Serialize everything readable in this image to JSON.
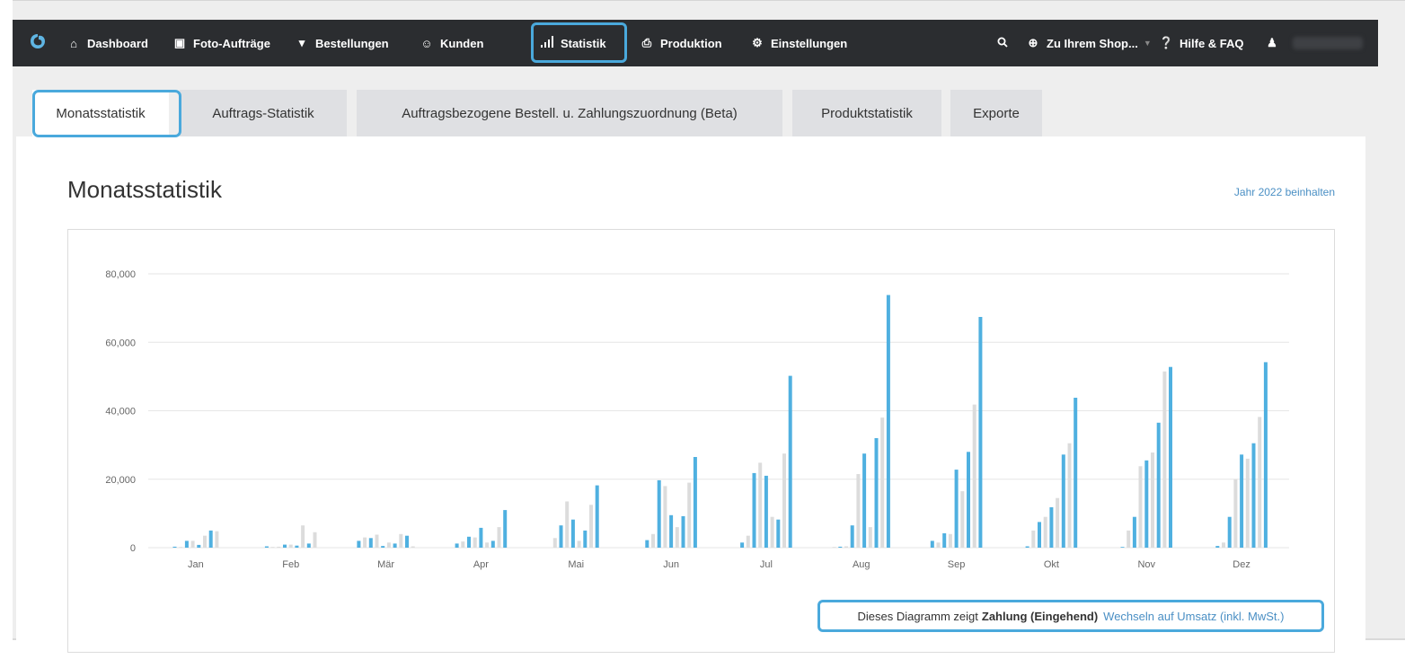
{
  "nav": {
    "items": [
      {
        "icon": "home-icon",
        "glyph": "⌂",
        "label": "Dashboard"
      },
      {
        "icon": "camera-icon",
        "glyph": "▣",
        "label": "Foto-Aufträge"
      },
      {
        "icon": "cart-icon",
        "glyph": "▾",
        "label": "Bestellungen"
      },
      {
        "icon": "users-icon",
        "glyph": "☺",
        "label": "Kunden"
      },
      {
        "icon": "bar-chart-icon",
        "glyph": "▐",
        "label": "Statistik"
      },
      {
        "icon": "printer-icon",
        "glyph": "⎙",
        "label": "Produktion"
      },
      {
        "icon": "gear-icon",
        "glyph": "⚙",
        "label": "Einstellungen"
      }
    ],
    "right": {
      "shop_label": "Zu Ihrem Shop...",
      "help_label": "Hilfe & FAQ"
    }
  },
  "tabs": [
    "Monatsstatistik",
    "Auftrags-Statistik",
    "Auftragsbezogene Bestell. u. Zahlungszuordnung (Beta)",
    "Produktstatistik",
    "Exporte"
  ],
  "page": {
    "title": "Monatsstatistik",
    "year_link": "Jahr 2022 beinhalten"
  },
  "footer": {
    "prefix": "Dieses Diagramm zeigt",
    "bold": "Zahlung (Eingehend)",
    "link": "Wechseln auf Umsatz (inkl. MwSt.)"
  },
  "colors": {
    "accent": "#4aa9dc",
    "bar_blue": "#4fb0e0",
    "bar_gray": "#dcdcdc",
    "nav_bg": "#2b2d30"
  },
  "chart_data": {
    "type": "bar",
    "categories": [
      "Jan",
      "Feb",
      "Mär",
      "Apr",
      "Mai",
      "Jun",
      "Jul",
      "Aug",
      "Sep",
      "Okt",
      "Nov",
      "Dez"
    ],
    "yticks": [
      "0",
      "20,000",
      "40,000",
      "60,000",
      "80,000"
    ],
    "ylim": [
      0,
      80000
    ],
    "grid": true,
    "bars_per_month": [
      [
        {
          "v": 300,
          "c": "b"
        },
        {
          "v": 200,
          "c": "g"
        },
        {
          "v": 2000,
          "c": "b"
        },
        {
          "v": 2000,
          "c": "g"
        },
        {
          "v": 800,
          "c": "b"
        },
        {
          "v": 3500,
          "c": "g"
        },
        {
          "v": 5000,
          "c": "b"
        },
        {
          "v": 4800,
          "c": "g"
        }
      ],
      [
        {
          "v": 400,
          "c": "b"
        },
        {
          "v": 200,
          "c": "g"
        },
        {
          "v": 300,
          "c": "g"
        },
        {
          "v": 900,
          "c": "b"
        },
        {
          "v": 900,
          "c": "g"
        },
        {
          "v": 600,
          "c": "b"
        },
        {
          "v": 6500,
          "c": "g"
        },
        {
          "v": 1200,
          "c": "b"
        },
        {
          "v": 4500,
          "c": "g"
        }
      ],
      [
        {
          "v": 2000,
          "c": "b"
        },
        {
          "v": 3000,
          "c": "g"
        },
        {
          "v": 2800,
          "c": "b"
        },
        {
          "v": 3800,
          "c": "g"
        },
        {
          "v": 500,
          "c": "b"
        },
        {
          "v": 1500,
          "c": "g"
        },
        {
          "v": 1200,
          "c": "b"
        },
        {
          "v": 4000,
          "c": "g"
        },
        {
          "v": 3500,
          "c": "b"
        },
        {
          "v": 400,
          "c": "g"
        }
      ],
      [
        {
          "v": 1200,
          "c": "b"
        },
        {
          "v": 1800,
          "c": "g"
        },
        {
          "v": 3200,
          "c": "b"
        },
        {
          "v": 3000,
          "c": "g"
        },
        {
          "v": 5800,
          "c": "b"
        },
        {
          "v": 1500,
          "c": "g"
        },
        {
          "v": 2000,
          "c": "b"
        },
        {
          "v": 6000,
          "c": "g"
        },
        {
          "v": 11000,
          "c": "b"
        }
      ],
      [
        {
          "v": 2800,
          "c": "g"
        },
        {
          "v": 6500,
          "c": "b"
        },
        {
          "v": 13500,
          "c": "g"
        },
        {
          "v": 8200,
          "c": "b"
        },
        {
          "v": 2000,
          "c": "g"
        },
        {
          "v": 5000,
          "c": "b"
        },
        {
          "v": 12500,
          "c": "g"
        },
        {
          "v": 18200,
          "c": "b"
        }
      ],
      [
        {
          "v": 2200,
          "c": "b"
        },
        {
          "v": 4000,
          "c": "g"
        },
        {
          "v": 19700,
          "c": "b"
        },
        {
          "v": 18000,
          "c": "g"
        },
        {
          "v": 9500,
          "c": "b"
        },
        {
          "v": 6000,
          "c": "g"
        },
        {
          "v": 9200,
          "c": "b"
        },
        {
          "v": 19000,
          "c": "g"
        },
        {
          "v": 26500,
          "c": "b"
        }
      ],
      [
        {
          "v": 1500,
          "c": "b"
        },
        {
          "v": 3500,
          "c": "g"
        },
        {
          "v": 21800,
          "c": "b"
        },
        {
          "v": 24800,
          "c": "g"
        },
        {
          "v": 21000,
          "c": "b"
        },
        {
          "v": 9000,
          "c": "g"
        },
        {
          "v": 8200,
          "c": "b"
        },
        {
          "v": 27500,
          "c": "g"
        },
        {
          "v": 50200,
          "c": "b"
        }
      ],
      [
        {
          "v": 200,
          "c": "g"
        },
        {
          "v": 300,
          "c": "b"
        },
        {
          "v": 400,
          "c": "g"
        },
        {
          "v": 6500,
          "c": "b"
        },
        {
          "v": 21500,
          "c": "g"
        },
        {
          "v": 27500,
          "c": "b"
        },
        {
          "v": 6000,
          "c": "g"
        },
        {
          "v": 32000,
          "c": "b"
        },
        {
          "v": 38000,
          "c": "g"
        },
        {
          "v": 73800,
          "c": "b"
        }
      ],
      [
        {
          "v": 2000,
          "c": "b"
        },
        {
          "v": 1500,
          "c": "g"
        },
        {
          "v": 4200,
          "c": "b"
        },
        {
          "v": 4000,
          "c": "g"
        },
        {
          "v": 22800,
          "c": "b"
        },
        {
          "v": 16500,
          "c": "g"
        },
        {
          "v": 28000,
          "c": "b"
        },
        {
          "v": 41800,
          "c": "g"
        },
        {
          "v": 67400,
          "c": "b"
        }
      ],
      [
        {
          "v": 400,
          "c": "b"
        },
        {
          "v": 5000,
          "c": "g"
        },
        {
          "v": 7500,
          "c": "b"
        },
        {
          "v": 9000,
          "c": "g"
        },
        {
          "v": 11800,
          "c": "b"
        },
        {
          "v": 14500,
          "c": "g"
        },
        {
          "v": 27200,
          "c": "b"
        },
        {
          "v": 30500,
          "c": "g"
        },
        {
          "v": 43800,
          "c": "b"
        }
      ],
      [
        {
          "v": 200,
          "c": "b"
        },
        {
          "v": 5000,
          "c": "g"
        },
        {
          "v": 9000,
          "c": "b"
        },
        {
          "v": 23800,
          "c": "g"
        },
        {
          "v": 25500,
          "c": "b"
        },
        {
          "v": 27800,
          "c": "g"
        },
        {
          "v": 36500,
          "c": "b"
        },
        {
          "v": 51500,
          "c": "g"
        },
        {
          "v": 52800,
          "c": "b"
        }
      ],
      [
        {
          "v": 500,
          "c": "b"
        },
        {
          "v": 1500,
          "c": "g"
        },
        {
          "v": 9000,
          "c": "b"
        },
        {
          "v": 20000,
          "c": "g"
        },
        {
          "v": 27200,
          "c": "b"
        },
        {
          "v": 26000,
          "c": "g"
        },
        {
          "v": 30500,
          "c": "b"
        },
        {
          "v": 38200,
          "c": "g"
        },
        {
          "v": 54200,
          "c": "b"
        }
      ]
    ]
  }
}
